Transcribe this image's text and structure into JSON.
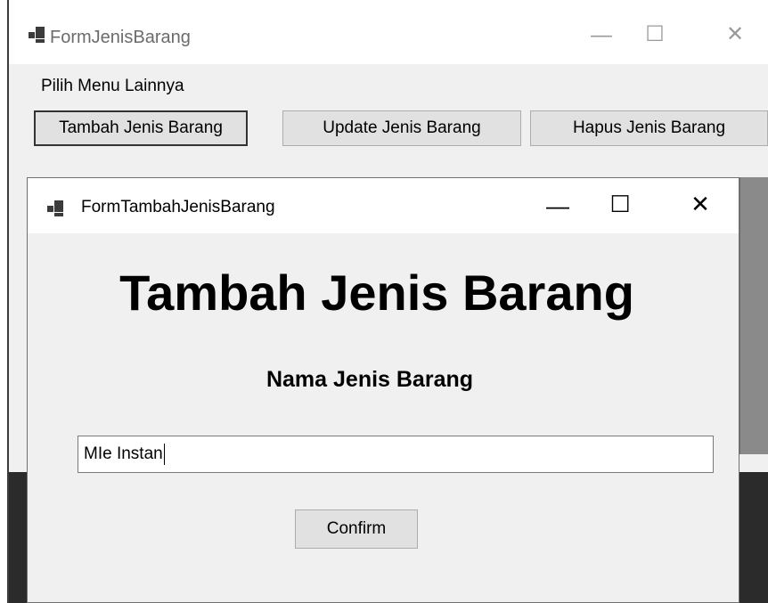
{
  "parent_window": {
    "title": "FormJenisBarang",
    "menu_label": "Pilih Menu Lainnya",
    "buttons": [
      {
        "label": "Tambah Jenis Barang"
      },
      {
        "label": "Update Jenis Barang"
      },
      {
        "label": "Hapus Jenis Barang"
      }
    ],
    "caption": {
      "minimize": "—",
      "maximize": "☐",
      "close": "✕"
    }
  },
  "child_window": {
    "title": "FormTambahJenisBarang",
    "heading": "Tambah Jenis Barang",
    "field_label": "Nama Jenis Barang",
    "input_value": "MIe Instan",
    "confirm_label": "Confirm",
    "caption": {
      "minimize": "—",
      "maximize": "☐",
      "close": "✕"
    }
  }
}
